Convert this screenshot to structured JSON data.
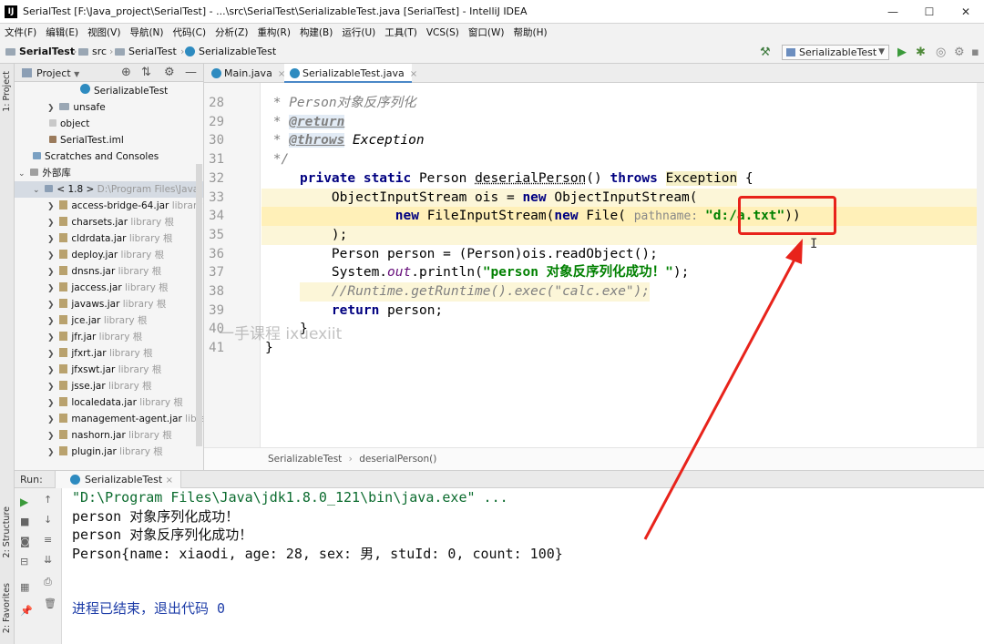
{
  "window": {
    "title": "SerialTest [F:\\Java_project\\SerialTest] - ...\\src\\SerialTest\\SerializableTest.java [SerialTest] - IntelliJ IDEA",
    "logo": "IJ",
    "controls": {
      "minimize": "—",
      "maximize": "☐",
      "close": "✕"
    }
  },
  "menu": [
    "文件(F)",
    "编辑(E)",
    "视图(V)",
    "导航(N)",
    "代码(C)",
    "分析(Z)",
    "重构(R)",
    "构建(B)",
    "运行(U)",
    "工具(T)",
    "VCS(S)",
    "窗口(W)",
    "帮助(H)"
  ],
  "navbar": {
    "crumbs": [
      "SerialTest",
      "src",
      "SerialTest",
      "SerializableTest"
    ],
    "run_config": "SerializableTest"
  },
  "left_strip": {
    "tabs": [
      "1: Project",
      "2: Structure",
      "2: Favorites"
    ]
  },
  "project": {
    "title": "Project",
    "items": [
      {
        "label": "SerializableTest",
        "note": "",
        "kind": "java"
      },
      {
        "label": "unsafe",
        "note": "",
        "kind": "folder"
      },
      {
        "label": "object",
        "note": "",
        "kind": "file"
      },
      {
        "label": "SerialTest.iml",
        "note": "",
        "kind": "file"
      },
      {
        "label": "Scratches and Consoles",
        "note": "",
        "kind": "scratch"
      },
      {
        "label": "外部库",
        "note": "",
        "kind": "lib"
      },
      {
        "label": "< 1.8 >",
        "note": "D:\\Program Files\\Java\\",
        "kind": "sdk"
      },
      {
        "label": "access-bridge-64.jar",
        "note": "library",
        "kind": "jar"
      },
      {
        "label": "charsets.jar",
        "note": "library 根",
        "kind": "jar"
      },
      {
        "label": "cldrdata.jar",
        "note": "library 根",
        "kind": "jar"
      },
      {
        "label": "deploy.jar",
        "note": "library 根",
        "kind": "jar"
      },
      {
        "label": "dnsns.jar",
        "note": "library 根",
        "kind": "jar"
      },
      {
        "label": "jaccess.jar",
        "note": "library 根",
        "kind": "jar"
      },
      {
        "label": "javaws.jar",
        "note": "library 根",
        "kind": "jar"
      },
      {
        "label": "jce.jar",
        "note": "library 根",
        "kind": "jar"
      },
      {
        "label": "jfr.jar",
        "note": "library 根",
        "kind": "jar"
      },
      {
        "label": "jfxrt.jar",
        "note": "library 根",
        "kind": "jar"
      },
      {
        "label": "jfxswt.jar",
        "note": "library 根",
        "kind": "jar"
      },
      {
        "label": "jsse.jar",
        "note": "library 根",
        "kind": "jar"
      },
      {
        "label": "localedata.jar",
        "note": "library 根",
        "kind": "jar"
      },
      {
        "label": "management-agent.jar",
        "note": "libra",
        "kind": "jar"
      },
      {
        "label": "nashorn.jar",
        "note": "library 根",
        "kind": "jar"
      },
      {
        "label": "plugin.jar",
        "note": "library 根",
        "kind": "jar"
      }
    ]
  },
  "tabs": [
    {
      "label": "Main.java",
      "active": false
    },
    {
      "label": "SerializableTest.java",
      "active": true
    }
  ],
  "editor": {
    "line_numbers": [
      "28",
      "29",
      "30",
      "31",
      "32",
      "33",
      "34",
      "35",
      "36",
      "37",
      "38",
      "39",
      "40",
      "41"
    ],
    "comment_1": " * Person对象反序列化",
    "tag_return": "@return",
    "tag_throws": "@throws",
    "throws_name": " Exception",
    "comment_end": " */",
    "l32_a": "private static",
    "l32_b": " Person ",
    "l32_c": "deserialPerson",
    "l32_d": "() ",
    "l32_e": "throws",
    "l32_f": "Exception",
    "l32_g": " {",
    "l33_a": "    ObjectInputStream ois = ",
    "l33_b": "new",
    "l33_c": " ObjectInputStream(",
    "l34_a": "            ",
    "l34_b": "new",
    "l34_c": " FileInputStream(",
    "l34_d": "new",
    "l34_e": " File( ",
    "l34_hint": "pathname: ",
    "l34_str": "\"d:/a.txt\"",
    "l34_end": "))",
    "l35": "    );",
    "l36": "    Person person = (Person)ois.readObject();",
    "l37_a": "    System.",
    "l37_b": "out",
    "l37_c": ".println(",
    "l37_str": "\"person 对象反序列化成功！\"",
    "l37_d": ");",
    "l38": "    //Runtime.getRuntime().exec(\"calc.exe\");",
    "l39_a": "    ",
    "l39_b": "return",
    "l39_c": " person;",
    "l40": "}",
    "l41": "}",
    "watermark": "一手课程 ixuexiit",
    "breadcrumb": [
      "SerializableTest",
      "deserialPerson()"
    ]
  },
  "run": {
    "label": "Run:",
    "tab": "SerializableTest",
    "console": [
      {
        "text": "\"D:\\Program Files\\Java\\jdk1.8.0_121\\bin\\java.exe\" ...",
        "kind": "cmd"
      },
      {
        "text": "person 对象序列化成功！",
        "kind": "out"
      },
      {
        "text": "person 对象反序列化成功！",
        "kind": "out"
      },
      {
        "text": "Person{name: xiaodi, age: 28, sex: 男, stuId: 0, count: 100}",
        "kind": "out"
      },
      {
        "text": "",
        "kind": "out"
      },
      {
        "text": "",
        "kind": "out"
      },
      {
        "text": "进程已结束，退出代码 0",
        "kind": "exit"
      }
    ]
  },
  "colors": {
    "annotation_red": "#e8231b",
    "accent_blue": "#4a88c7"
  },
  "icons": [
    "run-icon",
    "debug-icon",
    "coverage-icon",
    "profile-icon",
    "gear-icon",
    "hammer-icon",
    "folder-icon",
    "java-class-icon",
    "jar-icon"
  ]
}
